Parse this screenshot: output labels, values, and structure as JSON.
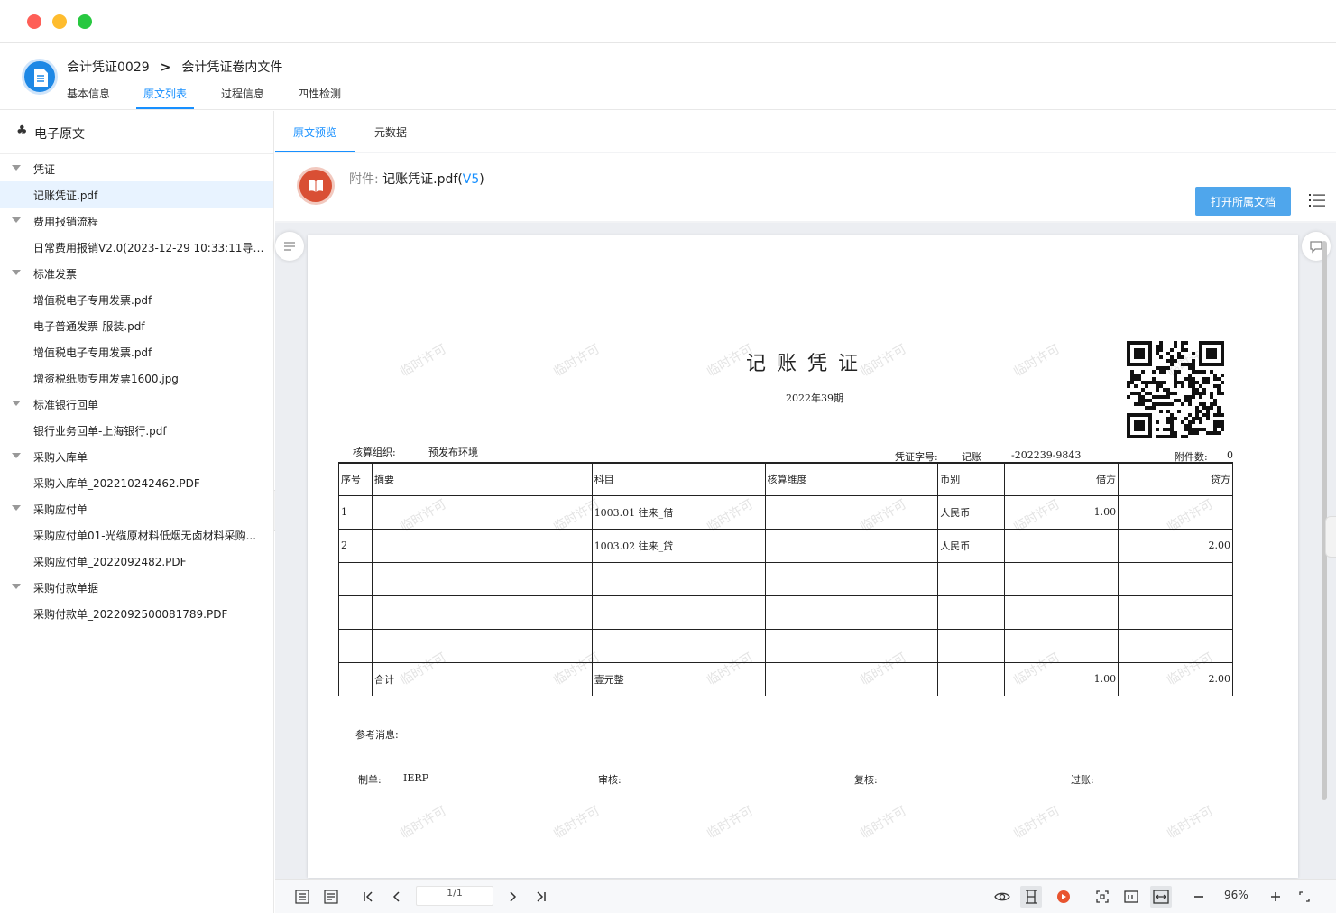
{
  "header": {
    "breadcrumb_1": "会计凭证0029",
    "breadcrumb_sep": ">",
    "breadcrumb_2": "会计凭证卷内文件",
    "tabs": [
      "基本信息",
      "原文列表",
      "过程信息",
      "四性检测"
    ],
    "active_tab": "原文列表"
  },
  "sidebar": {
    "title": "电子原文",
    "tree": [
      {
        "label": "凭证",
        "group": true
      },
      {
        "label": "记账凭证.pdf",
        "selected": true
      },
      {
        "label": "费用报销流程",
        "group": true
      },
      {
        "label": "日常费用报销V2.0(2023-12-29 10:33:11导入)..."
      },
      {
        "label": "标准发票",
        "group": true
      },
      {
        "label": "增值税电子专用发票.pdf"
      },
      {
        "label": "电子普通发票-服装.pdf"
      },
      {
        "label": "增值税电子专用发票.pdf"
      },
      {
        "label": "增资税纸质专用发票1600.jpg"
      },
      {
        "label": "标准银行回单",
        "group": true
      },
      {
        "label": "银行业务回单-上海银行.pdf"
      },
      {
        "label": "采购入库单",
        "group": true
      },
      {
        "label": "采购入库单_202210242462.PDF"
      },
      {
        "label": "采购应付单",
        "group": true
      },
      {
        "label": "采购应付单01-光缆原材料低烟无卤材料采购..."
      },
      {
        "label": "采购应付单_2022092482.PDF"
      },
      {
        "label": "采购付款单据",
        "group": true
      },
      {
        "label": "采购付款单_2022092500081789.PDF"
      }
    ]
  },
  "main": {
    "tabs": [
      "原文预览",
      "元数据"
    ],
    "attachment_label": "附件:",
    "attachment_name": "记账凭证.pdf",
    "version_open": "(",
    "version": "V5",
    "version_close": ")",
    "open_button": "打开所属文档"
  },
  "voucher": {
    "title": "记账凭证",
    "period": "2022年39期",
    "org_label": "核算组织:",
    "org_value": "预发布环境",
    "no_label": "凭证字号:",
    "no_type": "记账",
    "no_value": "-202239-9843",
    "attach_label": "附件数:",
    "attach_value": "0",
    "watermark": "临时许可",
    "headers": [
      "序号",
      "摘要",
      "科目",
      "核算维度",
      "币别",
      "借方",
      "贷方"
    ],
    "rows": [
      [
        "1",
        "",
        "1003.01 往来_借",
        "",
        "人民币",
        "1.00",
        ""
      ],
      [
        "2",
        "",
        "1003.02 往来_贷",
        "",
        "人民币",
        "",
        "2.00"
      ],
      [
        "",
        "",
        "",
        "",
        "",
        "",
        ""
      ],
      [
        "",
        "",
        "",
        "",
        "",
        "",
        ""
      ],
      [
        "",
        "",
        "",
        "",
        "",
        "",
        ""
      ]
    ],
    "total": [
      "",
      "合计",
      "壹元整",
      "",
      "",
      "1.00",
      "2.00"
    ],
    "ref_label": "参考消息:",
    "maker_label": "制单:",
    "maker_value": "IERP",
    "audit_label": "审核:",
    "review_label": "复核:",
    "post_label": "过账:"
  },
  "toolbar": {
    "page": "1/1",
    "zoom": "96%"
  },
  "colors": {
    "accent": "#1890ff",
    "button": "#4fa6ec",
    "book_icon": "#d94f34",
    "logo": "#1e88e5"
  }
}
